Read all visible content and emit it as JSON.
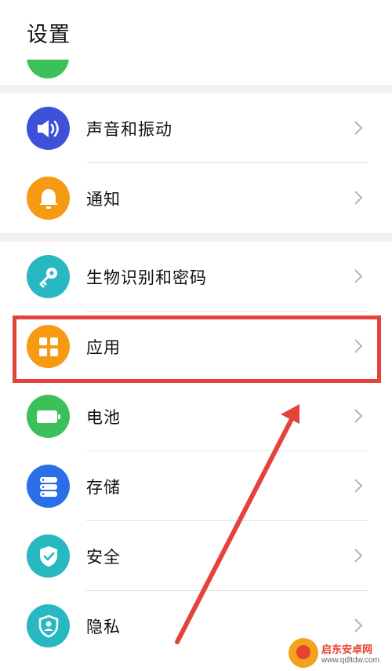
{
  "header": {
    "title": "设置"
  },
  "groups": [
    {
      "items": [
        {
          "label": "声音和振动",
          "icon": "sound-icon",
          "color": "#3f51d8"
        },
        {
          "label": "通知",
          "icon": "bell-icon",
          "color": "#f59a12"
        }
      ]
    },
    {
      "items": [
        {
          "label": "生物识别和密码",
          "icon": "key-icon",
          "color": "#27b8c2"
        },
        {
          "label": "应用",
          "icon": "apps-grid-icon",
          "color": "#f59a12",
          "highlighted": true
        },
        {
          "label": "电池",
          "icon": "battery-icon",
          "color": "#3cc15a"
        },
        {
          "label": "存储",
          "icon": "storage-icon",
          "color": "#2a6fe8"
        },
        {
          "label": "安全",
          "icon": "shield-check-icon",
          "color": "#27b8c2"
        },
        {
          "label": "隐私",
          "icon": "privacy-shield-icon",
          "color": "#27b8c2"
        }
      ]
    }
  ],
  "annotation": {
    "highlight_color": "#e2443b"
  },
  "watermark": {
    "title": "启东安卓网",
    "url": "www.qdltdw.com"
  }
}
